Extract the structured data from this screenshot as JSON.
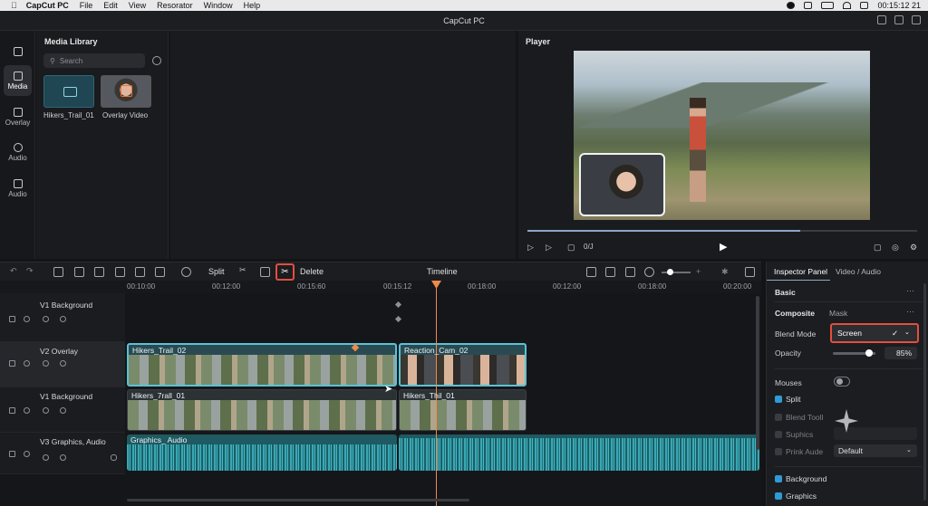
{
  "menubar": {
    "app": "CapCut PC",
    "items": [
      "File",
      "Edit",
      "View",
      "Resorator",
      "Window",
      "Help"
    ],
    "clock": "00:15:12  21"
  },
  "window": {
    "title": "CapCut PC"
  },
  "leftnav": [
    {
      "label": "Media",
      "icon": "media-icon",
      "active": true
    },
    {
      "label": "Overlay",
      "icon": "overlay-icon"
    },
    {
      "label": "Audio",
      "icon": "music-note-icon"
    },
    {
      "label": "Audio",
      "icon": "speaker-icon"
    }
  ],
  "media": {
    "title": "Media Library",
    "search_placeholder": "Search",
    "items": [
      {
        "label": "Hikers_Trail_01",
        "icon": "folder-icon"
      },
      {
        "label": "Overlay Video",
        "icon": "video-thumbnail"
      }
    ]
  },
  "player": {
    "title": "Player",
    "time": "0/J",
    "progress": 0.7
  },
  "toolbar": {
    "split": "Split",
    "delete": "Delete",
    "timeline": "Timeline"
  },
  "ruler": [
    "00:10:00",
    "00:12:00",
    "00:15:60",
    "00:15:12",
    "00:18:00",
    "00:12:00",
    "00:18:00",
    "00:20:00"
  ],
  "tracks": [
    {
      "name": "V1 Background"
    },
    {
      "name": "V2 Overlay"
    },
    {
      "name": "V1 Background"
    },
    {
      "name": "V3 Graphics, Audio"
    }
  ],
  "clips": {
    "v2_a": "Hikers_Trail_02",
    "v2_b": "Reaction_Cam_02",
    "v1_a": "Hikers_7rall_01",
    "v1_b": "Hikers_Thil_01",
    "audio": "Graphics_ Audio"
  },
  "inspector": {
    "tab1": "Inspector Panel",
    "tab2": "Video / Audio",
    "basic": "Basic",
    "composite": "Composite",
    "mask": "Mask",
    "blend_label": "Blend Mode",
    "blend_value": "Screen",
    "opacity_label": "Opacity",
    "opacity_value": "85%",
    "opacity_level": 0.85,
    "mouses": "Mouses",
    "split": "Split",
    "blend_tool": "Blend Tooll",
    "suphics": "Suphics",
    "prink_audio": "Prink Aude",
    "prink_value": "Default",
    "background": "Background",
    "graphics": "Graphics"
  },
  "colors": {
    "accent": "#e24f3f",
    "playhead": "#f08a4b",
    "clip_border": "#59c3d6",
    "checkbox": "#2f9bd6"
  }
}
